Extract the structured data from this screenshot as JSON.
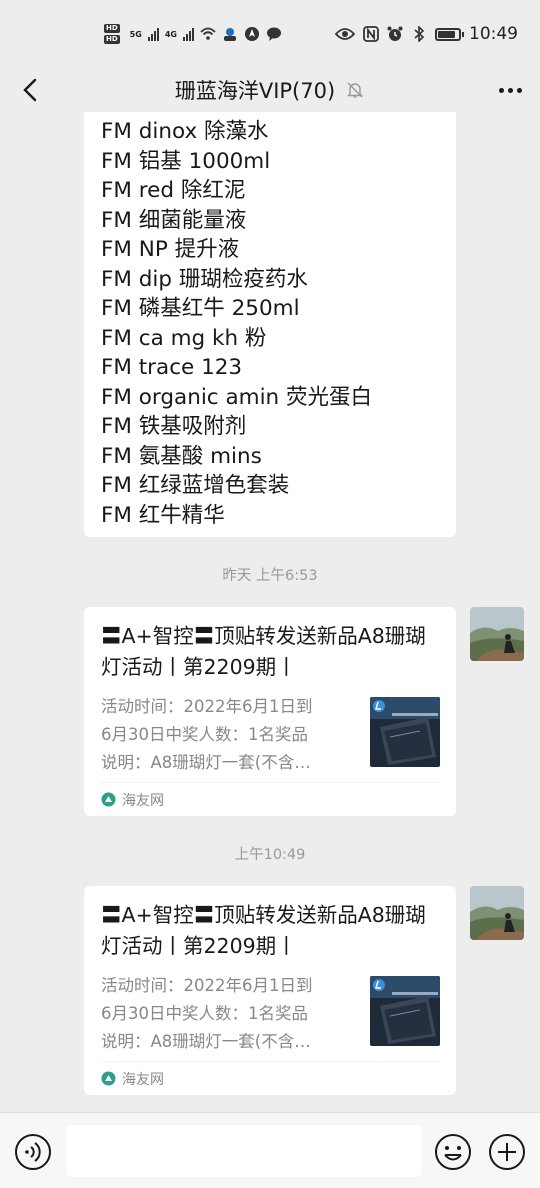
{
  "status_bar": {
    "sim1": "HD",
    "sim2": "HD",
    "net1": "5G",
    "net2": "4G",
    "battery_level": 0.85,
    "time": "10:49"
  },
  "nav": {
    "title": "珊蓝海洋VIP(70)"
  },
  "messages": {
    "text_lines": [
      "FM dinox 除藻水",
      "FM 铝基 1000ml",
      "FM red 除红泥",
      "FM 细菌能量液",
      "FM NP 提升液",
      "FM dip 珊瑚检疫药水",
      "FM 磷基红牛 250ml",
      "FM ca mg kh 粉",
      "FM trace 123",
      "FM organic amin 荧光蛋白",
      "FM 铁基吸附剂",
      "FM 氨基酸 mins",
      "FM 红绿蓝增色套装",
      "FM 红牛精华"
    ],
    "time1": "昨天 上午6:53",
    "card1": {
      "title": "〓A+智控〓顶贴转发送新品A8珊瑚灯活动丨第2209期丨",
      "desc_lines": [
        "活动时间：2022年6月1日到",
        "6月30日中奖人数：1名奖品",
        "说明：A8珊瑚灯一套(不含…"
      ],
      "source": "海友网"
    },
    "time2": "上午10:49",
    "card2": {
      "title": "〓A+智控〓顶贴转发送新品A8珊瑚灯活动丨第2209期丨",
      "desc_lines": [
        "活动时间：2022年6月1日到",
        "6月30日中奖人数：1名奖品",
        "说明：A8珊瑚灯一套(不含…"
      ],
      "source": "海友网"
    }
  },
  "input_bar": {
    "value": "",
    "placeholder": ""
  },
  "icons": {
    "back": "back-arrow-icon",
    "mute": "mute-bell-icon",
    "more": "more-dots-icon",
    "voice": "voice-icon",
    "emoji": "emoji-icon",
    "plus": "plus-icon"
  },
  "colors": {
    "background": "#ededed",
    "bubble": "#ffffff",
    "secondary_text": "#888888",
    "source_icon": "#2f9d8a"
  }
}
